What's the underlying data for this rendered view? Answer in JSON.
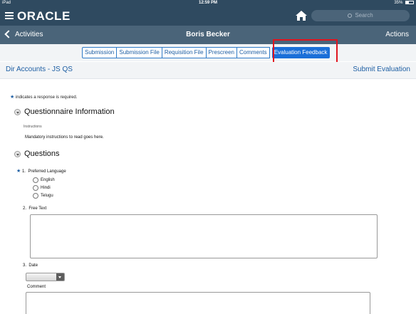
{
  "status_bar": {
    "left": "iPad",
    "time": "12:59 PM",
    "battery": "35%"
  },
  "app_bar": {
    "logo": "ORACLE",
    "search_placeholder": "Search"
  },
  "title_bar": {
    "back_label": "Activities",
    "title": "Boris  Becker",
    "actions_label": "Actions"
  },
  "tabs": [
    {
      "label": "Submission",
      "active": false
    },
    {
      "label": "Submission File",
      "active": false
    },
    {
      "label": "Requisition File",
      "active": false
    },
    {
      "label": "Prescreen",
      "active": false
    },
    {
      "label": "Comments",
      "active": false
    },
    {
      "label": "Evaluation Feedback",
      "active": true
    }
  ],
  "sub_header": {
    "left": "Dir Accounts - JS QS",
    "right": "Submit Evaluation"
  },
  "required_note": "indicates a response is required.",
  "questionnaire": {
    "heading": "Questionnaire Information",
    "instructions_label": "Instructions",
    "instructions_text": "Mandatory instructions to read goes here."
  },
  "questions": {
    "heading": "Questions",
    "q1": {
      "number": "1.",
      "label": "Preferred Language",
      "options": [
        "English",
        "Hindi",
        "Telugu"
      ]
    },
    "q2": {
      "number": "2.",
      "label": "Free Text"
    },
    "q3": {
      "number": "3.",
      "label": "Date",
      "comment_label": "Comment"
    }
  },
  "colors": {
    "header_dark": "#2f4a60",
    "header_mid": "#4a6479",
    "link_blue": "#1d5ea3",
    "active_tab": "#1a6fd8",
    "highlight_red": "#e0141e"
  }
}
